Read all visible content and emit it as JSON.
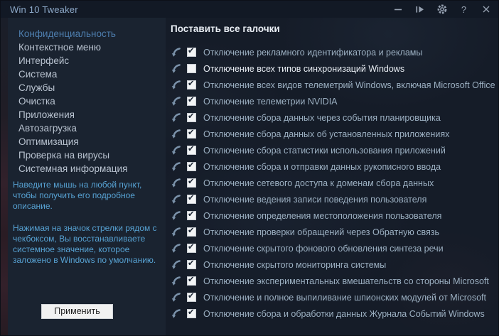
{
  "window": {
    "title": "Win 10 Tweaker"
  },
  "titlebar": {
    "icons": {
      "minimize-icon": "─",
      "run-icon": "|▶",
      "settings-icon": "gear",
      "help-icon": "?",
      "close-icon": "×"
    },
    "help_glyph": "?"
  },
  "sidebar": {
    "items": [
      {
        "label": "Конфиденциальность",
        "active": true
      },
      {
        "label": "Контекстное меню",
        "active": false
      },
      {
        "label": "Интерфейс",
        "active": false
      },
      {
        "label": "Система",
        "active": false
      },
      {
        "label": "Службы",
        "active": false
      },
      {
        "label": "Очистка",
        "active": false
      },
      {
        "label": "Приложения",
        "active": false
      },
      {
        "label": "Автозагрузка",
        "active": false
      },
      {
        "label": "Оптимизация",
        "active": false
      },
      {
        "label": "Проверка на вирусы",
        "active": false
      },
      {
        "label": "Системная информация",
        "active": false
      }
    ],
    "hint_hover": "Наведите мышь на любой пункт, чтобы получить его подробное описание.",
    "hint_arrow": "Нажимая на значок стрелки рядом с чекбоксом, Вы восстанавливаете системное значение, которое заложено в Windows по умолчанию.",
    "apply_label": "Применить"
  },
  "main": {
    "header": "Поставить все галочки",
    "row_icons": {
      "restore-default-icon": "curved-arrow",
      "checked-icon": "✔"
    },
    "rows": [
      {
        "label": "Отключение рекламного идентификатора и рекламы",
        "checked": true,
        "highlight": false
      },
      {
        "label": "Отключение всех типов синхронизаций Windows",
        "checked": false,
        "highlight": true
      },
      {
        "label": "Отключение всех видов телеметрий Windows, включая Microsoft Office",
        "checked": true,
        "highlight": false
      },
      {
        "label": "Отключение телеметрии NVIDIA",
        "checked": true,
        "highlight": false
      },
      {
        "label": "Отключение сбора данных через события планировщика",
        "checked": true,
        "highlight": false
      },
      {
        "label": "Отключение сбора данных об установленных приложениях",
        "checked": true,
        "highlight": false
      },
      {
        "label": "Отключение сбора статистики использования приложений",
        "checked": true,
        "highlight": false
      },
      {
        "label": "Отключение сбора и отправки данных рукописного ввода",
        "checked": true,
        "highlight": false
      },
      {
        "label": "Отключение сетевого доступа к доменам сбора данных",
        "checked": true,
        "highlight": false
      },
      {
        "label": "Отключение ведения записи поведения пользователя",
        "checked": true,
        "highlight": false
      },
      {
        "label": "Отключение определения местоположения пользователя",
        "checked": true,
        "highlight": false
      },
      {
        "label": "Отключение проверки обращений через Обратную связь",
        "checked": true,
        "highlight": false
      },
      {
        "label": "Отключение скрытого фонового обновления синтеза речи",
        "checked": true,
        "highlight": false
      },
      {
        "label": "Отключение скрытого мониторинга системы",
        "checked": true,
        "highlight": false
      },
      {
        "label": "Отключение экспериментальных вмешательств со стороны Microsoft",
        "checked": true,
        "highlight": false
      },
      {
        "label": "Отключение и полное выпиливание шпионских модулей от Microsoft",
        "checked": true,
        "highlight": false
      },
      {
        "label": "Отключение сбора и обработки данных Журнала Событий Windows",
        "checked": true,
        "highlight": false
      }
    ]
  },
  "colors": {
    "accent_active": "#4d7dad",
    "hint_text": "#57a2d3",
    "row_text": "#9cb0c2",
    "highlight_text": "#e9eef4",
    "titlebar_bg": "#121925",
    "sidebar_bg": "#1a2330",
    "main_bg": "#151c28",
    "check": "#1d2735"
  }
}
